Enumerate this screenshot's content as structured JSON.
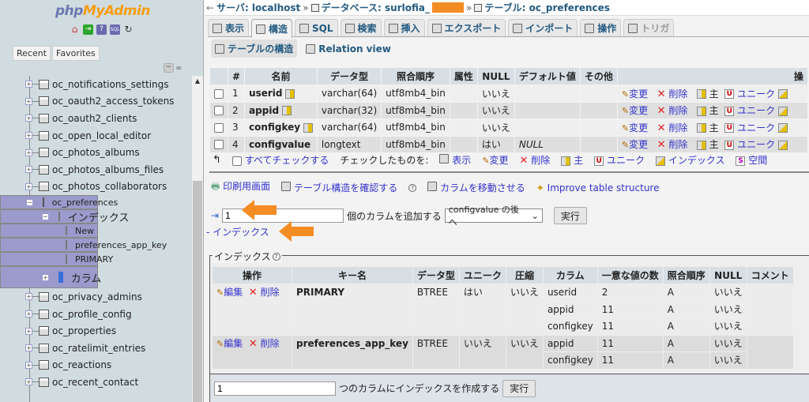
{
  "sidebar": {
    "logo": {
      "php": "php",
      "my": "MyAdmin"
    },
    "quick_icons": [
      "home-icon",
      "logout-icon",
      "docs-icon",
      "sql-docs-icon",
      "reload-icon"
    ],
    "tabs": [
      "Recent",
      "Favorites"
    ],
    "tree_before": [
      "oc_notifications_settings",
      "oc_oauth2_access_tokens",
      "oc_oauth2_clients",
      "oc_open_local_editor",
      "oc_photos_albums",
      "oc_photos_albums_files",
      "oc_photos_collaborators"
    ],
    "selected_table": "oc_preferences",
    "indexes_label": "インデックス",
    "index_children": [
      "New",
      "preferences_app_key",
      "PRIMARY"
    ],
    "columns_label": "カラム",
    "tree_after": [
      "oc_privacy_admins",
      "oc_profile_config",
      "oc_properties",
      "oc_ratelimit_entries",
      "oc_reactions",
      "oc_recent_contact"
    ]
  },
  "breadcrumb": {
    "server_label": "サーバ: localhost",
    "db_label": "データベース: surlofia_",
    "table_label": "テーブル: oc_preferences",
    "sep": "»"
  },
  "tabs": [
    {
      "label": "表示",
      "icon": "browse-icon"
    },
    {
      "label": "構造",
      "icon": "structure-icon",
      "active": true
    },
    {
      "label": "SQL",
      "icon": "sql-icon"
    },
    {
      "label": "検索",
      "icon": "search-icon"
    },
    {
      "label": "挿入",
      "icon": "insert-icon"
    },
    {
      "label": "エクスポート",
      "icon": "export-icon"
    },
    {
      "label": "インポート",
      "icon": "import-icon"
    },
    {
      "label": "操作",
      "icon": "operations-icon"
    },
    {
      "label": "トリガ",
      "icon": "triggers-icon",
      "disabled": true
    }
  ],
  "subtabs": [
    {
      "label": "テーブルの構造",
      "active": true
    },
    {
      "label": "Relation view"
    }
  ],
  "structure": {
    "headers": [
      "",
      "#",
      "名前",
      "データ型",
      "照合順序",
      "属性",
      "NULL",
      "デフォルト値",
      "その他",
      "操"
    ],
    "rows": [
      {
        "num": "1",
        "name": "userid",
        "primary": true,
        "type": "varchar(64)",
        "collation": "utf8mb4_bin",
        "attributes": "",
        "null": "いいえ",
        "default": "",
        "extra": ""
      },
      {
        "num": "2",
        "name": "appid",
        "primary": true,
        "type": "varchar(32)",
        "collation": "utf8mb4_bin",
        "attributes": "",
        "null": "いいえ",
        "default": "",
        "extra": ""
      },
      {
        "num": "3",
        "name": "configkey",
        "primary": true,
        "type": "varchar(64)",
        "collation": "utf8mb4_bin",
        "attributes": "",
        "null": "いいえ",
        "default": "",
        "extra": ""
      },
      {
        "num": "4",
        "name": "configvalue",
        "primary": false,
        "type": "longtext",
        "collation": "utf8mb4_bin",
        "attributes": "",
        "null": "はい",
        "default": "NULL",
        "extra": ""
      }
    ],
    "row_actions": {
      "change": "変更",
      "drop": "削除",
      "primary": "主",
      "unique": "ユニーク"
    }
  },
  "bulk": {
    "check_all": "すべてチェックする",
    "with_selected": "チェックしたものを:",
    "actions": [
      "表示",
      "変更",
      "削除",
      "主",
      "ユニーク",
      "インデックス",
      "空間"
    ]
  },
  "tools": {
    "print": "印刷用画面",
    "propose": "テーブル構造を確認する",
    "move_columns": "カラムを移動させる",
    "improve": "Improve table structure"
  },
  "add_column": {
    "count_value": "1",
    "label": "個のカラムを追加する",
    "position_selected": "configvalue の後へ",
    "go": "実行"
  },
  "index_toggle": "- インデックス",
  "indexes": {
    "legend": "インデックス",
    "headers": [
      "操作",
      "キー名",
      "データ型",
      "ユニーク",
      "圧縮",
      "カラム",
      "一意な値の数",
      "照合順序",
      "NULL",
      "コメント"
    ],
    "edit": "編集",
    "drop": "削除",
    "rows": [
      {
        "keyname": "PRIMARY",
        "type": "BTREE",
        "unique": "はい",
        "packed": "いいえ",
        "columns": [
          {
            "column": "userid",
            "cardinality": "2",
            "collation": "A",
            "null": "いいえ"
          },
          {
            "column": "appid",
            "cardinality": "11",
            "collation": "A",
            "null": "いいえ"
          },
          {
            "column": "configkey",
            "cardinality": "11",
            "collation": "A",
            "null": "いいえ"
          }
        ],
        "comment": ""
      },
      {
        "keyname": "preferences_app_key",
        "type": "BTREE",
        "unique": "いいえ",
        "packed": "いいえ",
        "columns": [
          {
            "column": "appid",
            "cardinality": "11",
            "collation": "A",
            "null": "いいえ"
          },
          {
            "column": "configkey",
            "cardinality": "11",
            "collation": "A",
            "null": "いいえ"
          }
        ],
        "comment": ""
      }
    ],
    "create_count": "1",
    "create_label": "つのカラムにインデックスを作成する",
    "go": "実行"
  },
  "colors": {
    "sidebar_bg": "#d0dce0",
    "selected_bg": "#9a9acc",
    "link": "#3333cc",
    "annotation_arrow": "#f48c24"
  }
}
